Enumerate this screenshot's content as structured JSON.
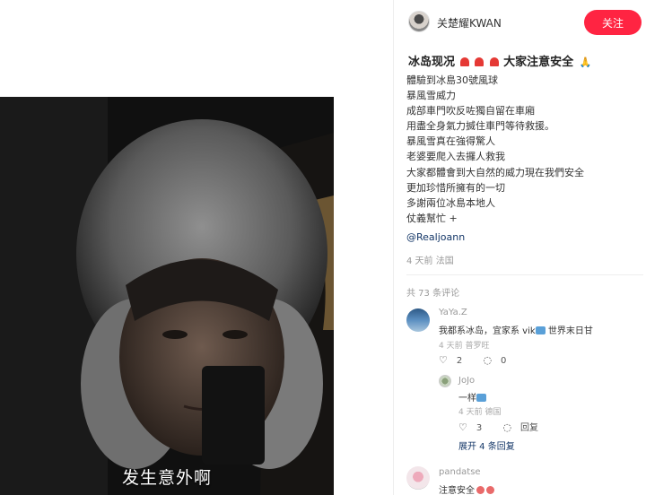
{
  "video": {
    "subtitle": "发生意外啊"
  },
  "author": {
    "name": "关楚耀KWAN",
    "follow_label": "关注"
  },
  "post": {
    "title": "冰岛现况",
    "title_suffix": "大家注意安全",
    "lines": [
      "體驗到冰島30號風球",
      "暴風雪威力",
      "成部車門吹反咗獨自留在車廂",
      "用盡全身氣力搣住車門等待救援。",
      "暴風雪真在強得驚人",
      "老婆要爬入去攞人救我",
      "大家都體會到大自然的威力現在我們安全",
      "更加珍惜所擁有的一切",
      "多謝兩位冰島本地人",
      "仗義幫忙 +"
    ],
    "mention": "@Realjoann",
    "meta": "4 天前 法国"
  },
  "comments": {
    "count_label": "共 73 条评论",
    "items": [
      {
        "name": "YaYa.Z",
        "text": "我都系冰岛，宜家系 vik",
        "text_end": "世界末日甘",
        "meta": "4 天前 普罗旺",
        "likes": "2",
        "replies": "0",
        "reply": {
          "name": "JoJo",
          "text": "一样",
          "meta": "4 天前 德国",
          "likes": "3",
          "reply_label": "回复"
        },
        "expand_label": "展开 4 条回复"
      },
      {
        "name": "pandatse",
        "text": "注意安全"
      }
    ]
  },
  "colors": {
    "accent": "#ff2442",
    "link": "#133667"
  }
}
